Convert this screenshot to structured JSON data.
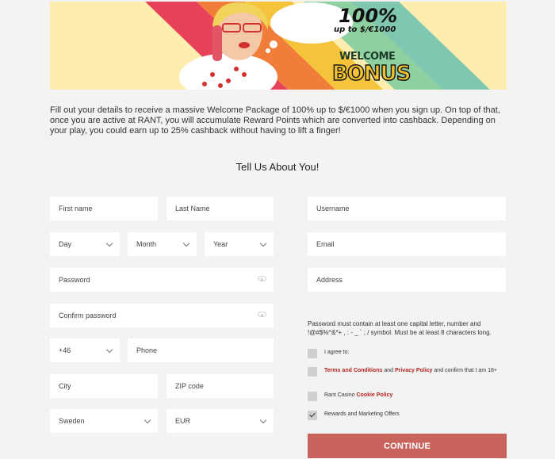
{
  "banner": {
    "percent": "100%",
    "upto": "up to $/€1000",
    "welcome": "WELCOME",
    "bonus": "BONUS"
  },
  "intro": "Fill out your details to receive a massive Welcome Package of 100% up to $/€1000 when you sign up. On top of that, once you are active at RANT, you will accumulate Reward Points which are converted into cashback. Depending on your play, you could earn up to 25% cashback without having to lift a finger!",
  "form_title": "Tell Us About You!",
  "fields": {
    "first_name": "First name",
    "last_name": "Last Name",
    "day": "Day",
    "month": "Month",
    "year": "Year",
    "password": "Password",
    "confirm_password": "Confirm password",
    "phone_code": "+46",
    "phone": "Phone",
    "city": "City",
    "zip": "ZIP code",
    "country": "Sweden",
    "currency": "EUR",
    "username": "Username",
    "email": "Email",
    "address": "Address"
  },
  "password_hint": "Password must contain at least one capital letter, number and !@#$%^&*+ , : - _ ` ; / symbol. Must be at least 8 characters long.",
  "checkboxes": {
    "agree": "I agree to:",
    "terms_link": "Terms and Conditions",
    "and": "and",
    "privacy_link": "Privacy Policy",
    "terms_tail": "and confirm that I am 18+",
    "cookie_prefix": "Rant Casino",
    "cookie_link": "Cookie Policy",
    "marketing": "Rewards and Marketing Offers",
    "marketing_checked": true
  },
  "continue_label": "CONTINUE",
  "colors": {
    "button": "#c8645d",
    "link": "#b3261e",
    "banner_bg": "#fdeeb0"
  }
}
